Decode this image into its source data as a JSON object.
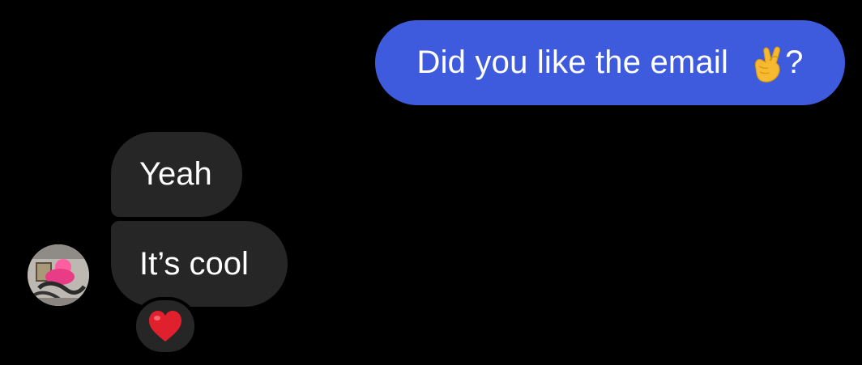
{
  "conversation": {
    "outgoing": [
      {
        "text_before": "Did you like the email",
        "emoji": "crossed-fingers",
        "text_after": "?"
      }
    ],
    "incoming": [
      {
        "text": "Yeah"
      },
      {
        "text": "It’s cool",
        "reaction": "red-heart"
      }
    ]
  },
  "colors": {
    "background": "#000000",
    "outgoing_bubble": "#3f5bdd",
    "incoming_bubble": "#262626",
    "text": "#ffffff",
    "reaction_heart": "#e0202c"
  }
}
